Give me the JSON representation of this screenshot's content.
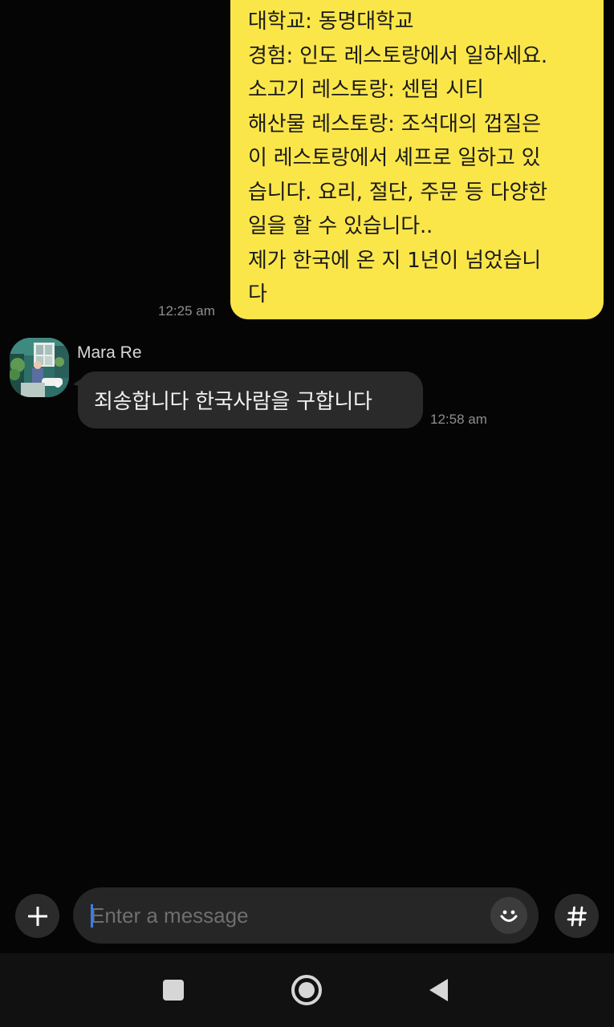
{
  "outgoing_message": {
    "lines": [
      "대학교: 동명대학교",
      "경험: 인도 레스토랑에서 일하세요.",
      "소고기 레스토랑: 센텀 시티",
      "해산물 레스토랑: 조석대의 껍질은",
      "이 레스토랑에서 셰프로 일하고 있",
      "습니다. 요리, 절단, 주문 등 다양한",
      "일을 할 수 있습니다..",
      "제가 한국에 온 지 1년이 넘었습니",
      "다"
    ],
    "time": "12:25 am"
  },
  "incoming_message": {
    "sender": "Mara Re",
    "text": "죄송합니다 한국사람을 구합니다",
    "time": "12:58 am"
  },
  "input_bar": {
    "placeholder": "Enter a message",
    "value": ""
  },
  "icons": {
    "attach": "plus-icon",
    "emoji": "emoji-smile-icon",
    "hashtag": "hash-icon",
    "nav_recents": "recents-square-icon",
    "nav_home": "home-circle-icon",
    "nav_back": "back-triangle-icon"
  },
  "colors": {
    "outgoing_bubble": "#fbe64a",
    "incoming_bubble": "#2a2a2a",
    "background": "#050505",
    "caret": "#3b7de8"
  }
}
